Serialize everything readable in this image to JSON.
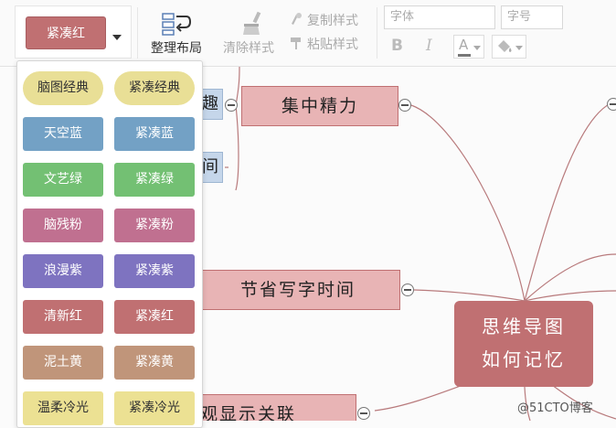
{
  "toolbar": {
    "theme_current": "紧凑红",
    "layout_label": "整理布局",
    "clear_style_label": "清除样式",
    "copy_style_label": "复制样式",
    "paste_style_label": "粘贴样式",
    "font_family_placeholder": "字体",
    "font_size_placeholder": "字号",
    "bold_label": "B",
    "italic_label": "I",
    "font_color_label": "A"
  },
  "theme_options": [
    {
      "label": "脑图经典",
      "color": "#e9df96",
      "text_color": "#333",
      "shape": "pill"
    },
    {
      "label": "紧凑经典",
      "color": "#e9df96",
      "text_color": "#333",
      "shape": "pill"
    },
    {
      "label": "天空蓝",
      "color": "#73a1c5",
      "text_color": "#fff",
      "shape": "rect"
    },
    {
      "label": "紧凑蓝",
      "color": "#73a1c5",
      "text_color": "#fff",
      "shape": "rect"
    },
    {
      "label": "文艺绿",
      "color": "#73c073",
      "text_color": "#fff",
      "shape": "rect"
    },
    {
      "label": "紧凑绿",
      "color": "#73c073",
      "text_color": "#fff",
      "shape": "rect"
    },
    {
      "label": "脑残粉",
      "color": "#c07090",
      "text_color": "#fff",
      "shape": "rect"
    },
    {
      "label": "紧凑粉",
      "color": "#c07090",
      "text_color": "#fff",
      "shape": "rect"
    },
    {
      "label": "浪漫紫",
      "color": "#7e73c0",
      "text_color": "#fff",
      "shape": "rect"
    },
    {
      "label": "紧凑紫",
      "color": "#7e73c0",
      "text_color": "#fff",
      "shape": "rect"
    },
    {
      "label": "清新红",
      "color": "#c07072",
      "text_color": "#fff",
      "shape": "rect"
    },
    {
      "label": "紧凑红",
      "color": "#c07072",
      "text_color": "#fff",
      "shape": "rect"
    },
    {
      "label": "泥土黄",
      "color": "#c0957a",
      "text_color": "#fff",
      "shape": "rect"
    },
    {
      "label": "紧凑黄",
      "color": "#c0957a",
      "text_color": "#fff",
      "shape": "rect"
    },
    {
      "label": "温柔冷光",
      "color": "#ece193",
      "text_color": "#333",
      "shape": "rect"
    },
    {
      "label": "紧凑冷光",
      "color": "#ece193",
      "text_color": "#333",
      "shape": "rect"
    }
  ],
  "mindmap": {
    "root_line1": "思维导图",
    "root_line2": "如何记忆",
    "node_focus": "集中精力",
    "node_save_time": "节省写字时间",
    "node_relation": "观显示关联",
    "node_partial_1": "趣",
    "node_partial_2": "间"
  },
  "watermark": "@51CTO博客",
  "colors": {
    "accent_red": "#c07072",
    "node_fill": "#e8b4b5",
    "link_color": "#b87a7c"
  }
}
